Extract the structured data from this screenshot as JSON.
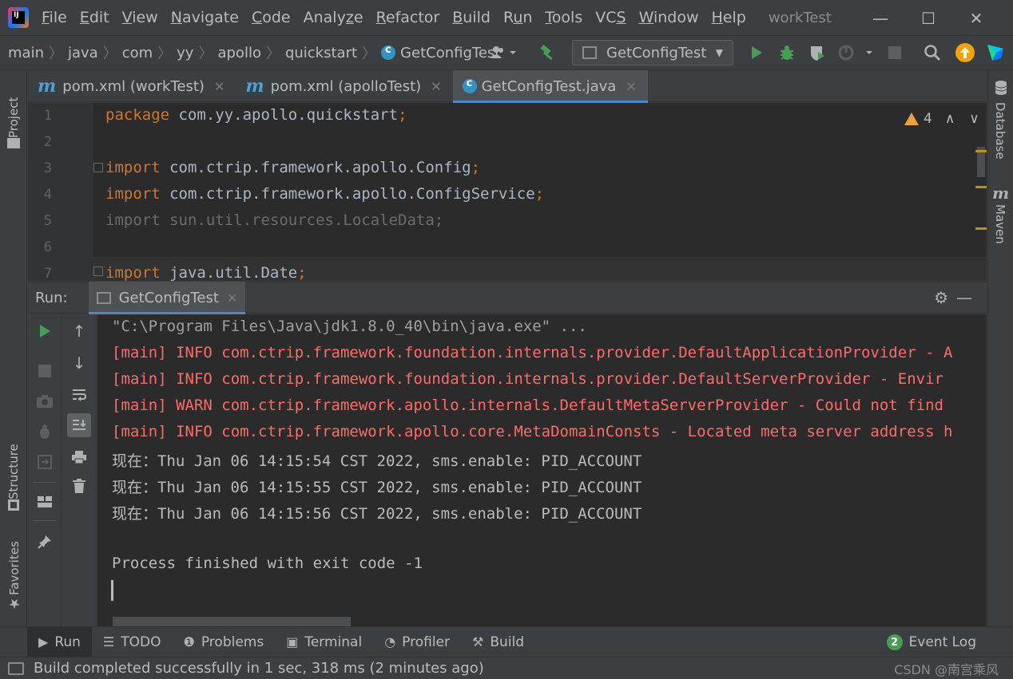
{
  "window": {
    "title": "workTest",
    "logo_text": "IJ",
    "controls": {
      "minimize": "—",
      "maximize": "☐",
      "close": "✕"
    }
  },
  "menu": [
    {
      "label": "File",
      "mnemonic": "F",
      "rest": "ile"
    },
    {
      "label": "Edit",
      "mnemonic": "E",
      "rest": "dit"
    },
    {
      "label": "View",
      "mnemonic": "V",
      "rest": "iew"
    },
    {
      "label": "Navigate",
      "mnemonic": "N",
      "rest": "avigate"
    },
    {
      "label": "Code",
      "mnemonic": "C",
      "rest": "ode"
    },
    {
      "label": "Analyze",
      "mnemonic": "",
      "rest": "Analy",
      "tail_mnemonic": "z",
      "tail": "e"
    },
    {
      "label": "Refactor",
      "mnemonic": "R",
      "rest": "efactor"
    },
    {
      "label": "Build",
      "mnemonic": "B",
      "rest": "uild"
    },
    {
      "label": "Run",
      "mnemonic": "",
      "rest": "R",
      "tail_mnemonic": "u",
      "tail": "n"
    },
    {
      "label": "Tools",
      "mnemonic": "T",
      "rest": "ools"
    },
    {
      "label": "VCS",
      "mnemonic": "",
      "rest": "VC",
      "tail_mnemonic": "S",
      "tail": ""
    },
    {
      "label": "Window",
      "mnemonic": "W",
      "rest": "indow"
    },
    {
      "label": "Help",
      "mnemonic": "H",
      "rest": "elp"
    }
  ],
  "breadcrumbs": [
    "main",
    "java",
    "com",
    "yy",
    "apollo",
    "quickstart",
    "GetConfigTest"
  ],
  "run_config": {
    "label": "GetConfigTest"
  },
  "editor_tabs": [
    {
      "label": "pom.xml (workTest)",
      "icon": "maven-icon",
      "active": false
    },
    {
      "label": "pom.xml (apolloTest)",
      "icon": "maven-icon",
      "active": false
    },
    {
      "label": "GetConfigTest.java",
      "icon": "class-icon",
      "active": true
    }
  ],
  "editor": {
    "inspection_count": "4",
    "lines": [
      {
        "no": "1",
        "kw": "package",
        "rest": " com.yy.apollo.quickstart",
        "semi": ";",
        "dim": false
      },
      {
        "no": "2",
        "kw": "",
        "rest": "",
        "semi": "",
        "dim": false
      },
      {
        "no": "3",
        "kw": "import",
        "rest": " com.ctrip.framework.apollo.Config",
        "semi": ";",
        "dim": false
      },
      {
        "no": "4",
        "kw": "import",
        "rest": " com.ctrip.framework.apollo.ConfigService",
        "semi": ";",
        "dim": false
      },
      {
        "no": "5",
        "kw": "import",
        "rest": " sun.util.resources.LocaleData;",
        "semi": "",
        "dim": true
      },
      {
        "no": "6",
        "kw": "",
        "rest": "",
        "semi": "",
        "dim": false
      },
      {
        "no": "7",
        "kw": "import",
        "rest": " java.util.Date",
        "semi": ";",
        "dim": false
      }
    ]
  },
  "run_panel": {
    "label": "Run:",
    "tab": "GetConfigTest"
  },
  "console": [
    {
      "text": "\"C:\\Program Files\\Java\\jdk1.8.0_40\\bin\\java.exe\" ...",
      "style": "grey"
    },
    {
      "text": "[main] INFO com.ctrip.framework.foundation.internals.provider.DefaultApplicationProvider - A",
      "style": "red"
    },
    {
      "text": "[main] INFO com.ctrip.framework.foundation.internals.provider.DefaultServerProvider - Envir",
      "style": "red"
    },
    {
      "text": "[main] WARN com.ctrip.framework.apollo.internals.DefaultMetaServerProvider - Could not find",
      "style": "red"
    },
    {
      "text": "[main] INFO com.ctrip.framework.apollo.core.MetaDomainConsts - Located meta server address h",
      "style": "red"
    },
    {
      "text": "现在：Thu Jan 06 14:15:54 CST 2022, sms.enable: PID_ACCOUNT",
      "style": "norm"
    },
    {
      "text": "现在：Thu Jan 06 14:15:55 CST 2022, sms.enable: PID_ACCOUNT",
      "style": "norm"
    },
    {
      "text": "现在：Thu Jan 06 14:15:56 CST 2022, sms.enable: PID_ACCOUNT",
      "style": "norm"
    },
    {
      "text": "",
      "style": "norm"
    },
    {
      "text": "Process finished with exit code -1",
      "style": "norm"
    }
  ],
  "side_tabs": {
    "project": "Project",
    "structure": "Structure",
    "favorites": "Favorites",
    "database": "Database",
    "maven": "Maven"
  },
  "bottom_tabs": [
    {
      "label": "Run",
      "icon": "run-icon",
      "glyph": "▶",
      "active": true
    },
    {
      "label": "TODO",
      "icon": "todo-icon",
      "glyph": "☰",
      "active": false
    },
    {
      "label": "Problems",
      "icon": "problems-icon",
      "glyph": "❶",
      "active": false
    },
    {
      "label": "Terminal",
      "icon": "terminal-icon",
      "glyph": "▣",
      "active": false
    },
    {
      "label": "Profiler",
      "icon": "profiler-icon",
      "glyph": "◔",
      "active": false
    },
    {
      "label": "Build",
      "icon": "build-icon",
      "glyph": "⚒",
      "active": false
    }
  ],
  "event_log": {
    "count": "2",
    "label": "Event Log"
  },
  "status": {
    "text": "Build completed successfully in 1 sec, 318 ms (2 minutes ago)",
    "watermark": "CSDN @南宫乘风"
  },
  "colors": {
    "keyword": "#cc7832",
    "console_error": "#ff6b68",
    "run_green": "#499c54",
    "accent_blue": "#4a88c7"
  }
}
